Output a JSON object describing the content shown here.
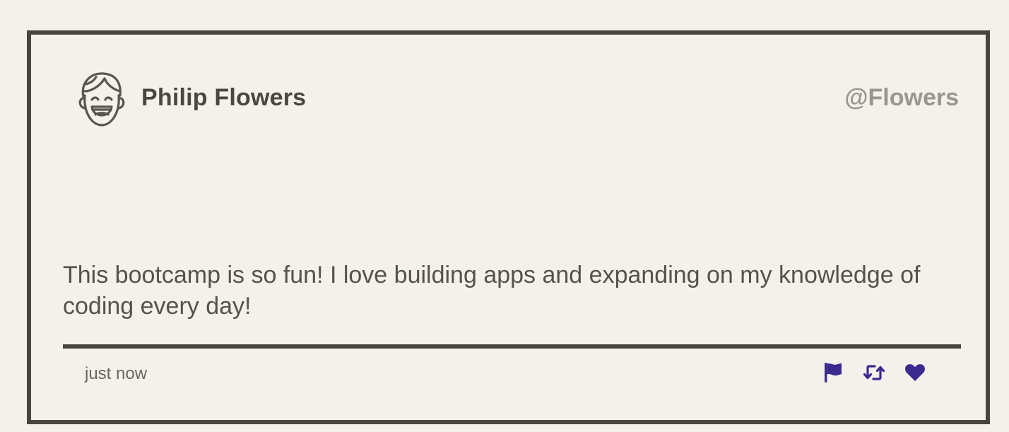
{
  "tweet": {
    "display_name": "Philip Flowers",
    "handle": "@Flowers",
    "text": "This bootcamp is so fun! I love building apps and expanding on my knowledge of coding every day!",
    "timestamp": "just now",
    "avatar_icon": "smiling-face-avatar-icon"
  },
  "actions": [
    {
      "icon": "flag-icon",
      "label": "flag"
    },
    {
      "icon": "retweet-icon",
      "label": "retweet"
    },
    {
      "icon": "heart-icon",
      "label": "like"
    }
  ],
  "colors": {
    "background": "#f4f1ec",
    "border": "#48443e",
    "text": "#4a4640",
    "handle": "#9a968f",
    "action_icon": "#3b2a8f"
  }
}
